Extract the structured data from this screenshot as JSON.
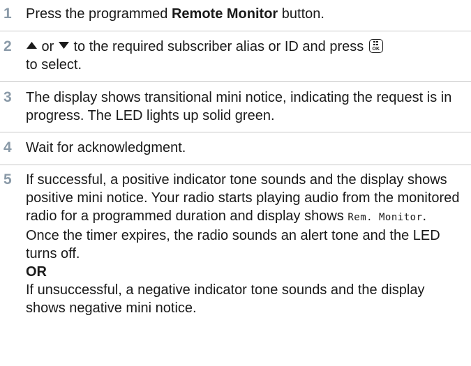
{
  "colors": {
    "step_number": "#8a9aa8",
    "separator": "#c8c8c8",
    "text": "#1a1a1a"
  },
  "steps": [
    {
      "number": "1",
      "pre": "Press the programmed ",
      "bold": "Remote Monitor",
      "post": " button."
    },
    {
      "number": "2",
      "up_icon": "arrow-up-icon",
      "or_text": " or ",
      "down_icon": "arrow-down-icon",
      "mid": " to the required subscriber alias or ID and press ",
      "ok_icon": "menu-ok-button-icon",
      "ok_label": "OK",
      "end": "to select."
    },
    {
      "number": "3",
      "text": "The display shows transitional mini notice, indicating the request is in progress. The LED lights up solid green."
    },
    {
      "number": "4",
      "text": "Wait for acknowledgment."
    },
    {
      "number": "5",
      "line1": "If successful, a positive indicator tone sounds and the display shows positive mini notice. Your radio starts playing audio from the monitored radio for a programmed duration and display shows ",
      "display_text": "Rem. Monitor",
      "line1_end": ".",
      "line2": "Once the timer expires, the radio sounds an alert tone and the LED turns off.",
      "or_label": "OR",
      "line3": "If unsuccessful, a negative indicator tone sounds and the display shows negative mini notice."
    }
  ]
}
